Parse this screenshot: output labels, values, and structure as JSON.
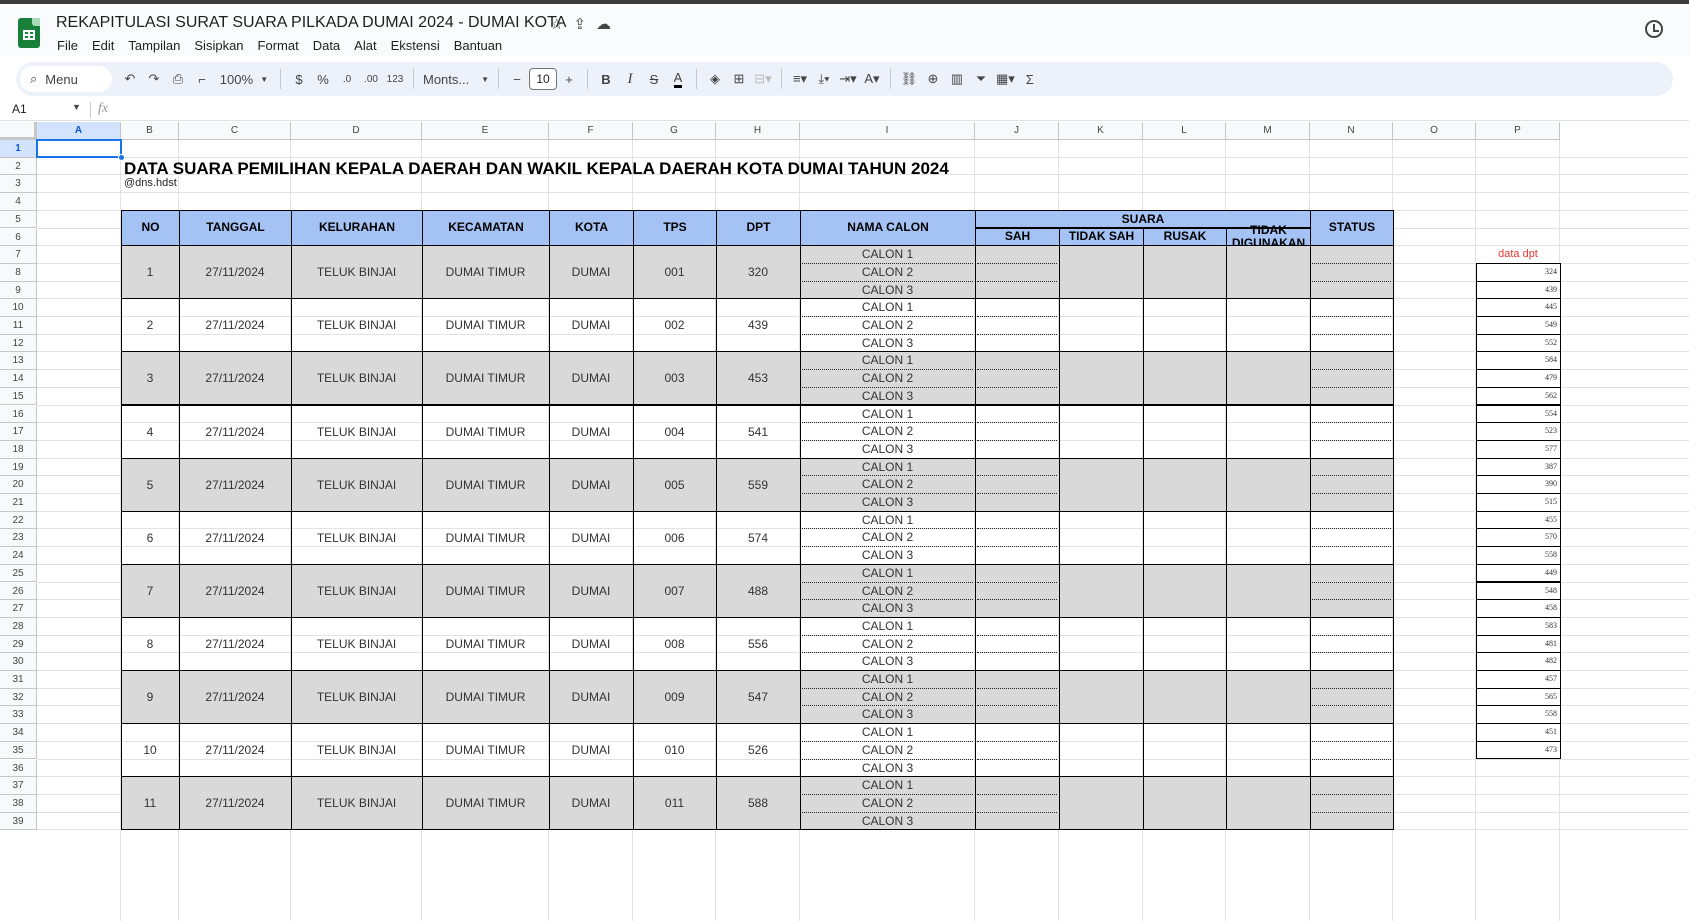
{
  "doc": {
    "title": "REKAPITULASI SURAT SUARA PILKADA DUMAI 2024 - DUMAI KOTA",
    "menu": [
      "File",
      "Edit",
      "Tampilan",
      "Sisipkan",
      "Format",
      "Data",
      "Alat",
      "Ekstensi",
      "Bantuan"
    ]
  },
  "toolbar": {
    "search_label": "Menu",
    "zoom": "100%",
    "currency": "$",
    "percent": "%",
    "dec_decrease": ".0",
    "dec_increase": ".00",
    "number_format": "123",
    "font": "Monts...",
    "font_size": "10",
    "bold": "B",
    "italic": "I",
    "strike": "S",
    "text_color": "A",
    "sigma": "Σ"
  },
  "formula_bar": {
    "cell_ref": "A1",
    "fx": "fx"
  },
  "columns": [
    "A",
    "B",
    "C",
    "D",
    "E",
    "F",
    "G",
    "H",
    "I",
    "J",
    "K",
    "L",
    "M",
    "N",
    "O",
    "P"
  ],
  "sheet": {
    "title": "DATA SUARA PEMILIHAN KEPALA DAERAH DAN WAKIL KEPALA DAERAH KOTA DUMAI TAHUN 2024",
    "subtitle": "@dns.hdst",
    "headers": {
      "no": "NO",
      "tanggal": "TANGGAL",
      "kelurahan": "KELURAHAN",
      "kecamatan": "KECAMATAN",
      "kota": "KOTA",
      "tps": "TPS",
      "dpt": "DPT",
      "nama_calon": "NAMA CALON",
      "suara": "SUARA",
      "sah": "SAH",
      "tidak_sah": "TIDAK SAH",
      "rusak": "RUSAK",
      "tidak_digunakan": "TIDAK DIGUNAKAN",
      "status": "STATUS"
    },
    "calon": [
      "CALON 1",
      "CALON 2",
      "CALON 3"
    ],
    "rows": [
      {
        "no": "1",
        "tanggal": "27/11/2024",
        "kelurahan": "TELUK BINJAI",
        "kecamatan": "DUMAI TIMUR",
        "kota": "DUMAI",
        "tps": "001",
        "dpt": "320"
      },
      {
        "no": "2",
        "tanggal": "27/11/2024",
        "kelurahan": "TELUK BINJAI",
        "kecamatan": "DUMAI TIMUR",
        "kota": "DUMAI",
        "tps": "002",
        "dpt": "439"
      },
      {
        "no": "3",
        "tanggal": "27/11/2024",
        "kelurahan": "TELUK BINJAI",
        "kecamatan": "DUMAI TIMUR",
        "kota": "DUMAI",
        "tps": "003",
        "dpt": "453"
      },
      {
        "no": "4",
        "tanggal": "27/11/2024",
        "kelurahan": "TELUK BINJAI",
        "kecamatan": "DUMAI TIMUR",
        "kota": "DUMAI",
        "tps": "004",
        "dpt": "541"
      },
      {
        "no": "5",
        "tanggal": "27/11/2024",
        "kelurahan": "TELUK BINJAI",
        "kecamatan": "DUMAI TIMUR",
        "kota": "DUMAI",
        "tps": "005",
        "dpt": "559"
      },
      {
        "no": "6",
        "tanggal": "27/11/2024",
        "kelurahan": "TELUK BINJAI",
        "kecamatan": "DUMAI TIMUR",
        "kota": "DUMAI",
        "tps": "006",
        "dpt": "574"
      },
      {
        "no": "7",
        "tanggal": "27/11/2024",
        "kelurahan": "TELUK BINJAI",
        "kecamatan": "DUMAI TIMUR",
        "kota": "DUMAI",
        "tps": "007",
        "dpt": "488"
      },
      {
        "no": "8",
        "tanggal": "27/11/2024",
        "kelurahan": "TELUK BINJAI",
        "kecamatan": "DUMAI TIMUR",
        "kota": "DUMAI",
        "tps": "008",
        "dpt": "556"
      },
      {
        "no": "9",
        "tanggal": "27/11/2024",
        "kelurahan": "TELUK BINJAI",
        "kecamatan": "DUMAI TIMUR",
        "kota": "DUMAI",
        "tps": "009",
        "dpt": "547"
      },
      {
        "no": "10",
        "tanggal": "27/11/2024",
        "kelurahan": "TELUK BINJAI",
        "kecamatan": "DUMAI TIMUR",
        "kota": "DUMAI",
        "tps": "010",
        "dpt": "526"
      },
      {
        "no": "11",
        "tanggal": "27/11/2024",
        "kelurahan": "TELUK BINJAI",
        "kecamatan": "DUMAI TIMUR",
        "kota": "DUMAI",
        "tps": "011",
        "dpt": "588"
      }
    ],
    "side_label": "data dpt",
    "side_values": [
      "324",
      "439",
      "445",
      "549",
      "552",
      "584",
      "479",
      "562",
      "554",
      "523",
      "577",
      "387",
      "390",
      "515",
      "455",
      "570",
      "558",
      "449",
      "548",
      "458",
      "583",
      "481",
      "482",
      "457",
      "565",
      "558",
      "451",
      "473"
    ]
  }
}
